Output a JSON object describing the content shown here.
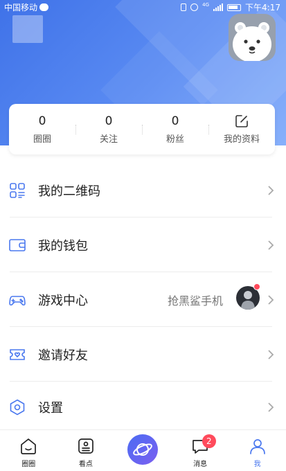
{
  "status_bar": {
    "carrier": "中国移动",
    "network": "4G",
    "time": "下午4:17"
  },
  "stats": [
    {
      "value": "0",
      "label": "圈圈"
    },
    {
      "value": "0",
      "label": "关注"
    },
    {
      "value": "0",
      "label": "粉丝"
    },
    {
      "label": "我的资料"
    }
  ],
  "menu": {
    "qrcode": {
      "label": "我的二维码"
    },
    "wallet": {
      "label": "我的钱包"
    },
    "games": {
      "label": "游戏中心",
      "subtitle": "抢黑鲨手机"
    },
    "invite": {
      "label": "邀请好友"
    },
    "settings": {
      "label": "设置"
    }
  },
  "tabs": [
    {
      "label": "圈圈"
    },
    {
      "label": "看点"
    },
    {
      "label": ""
    },
    {
      "label": "消息",
      "badge": "2"
    },
    {
      "label": "我"
    }
  ],
  "colors": {
    "accent": "#4a78ef",
    "badge": "#ff4b5c",
    "header_start": "#3f72e8",
    "header_end": "#7aa7fb"
  }
}
